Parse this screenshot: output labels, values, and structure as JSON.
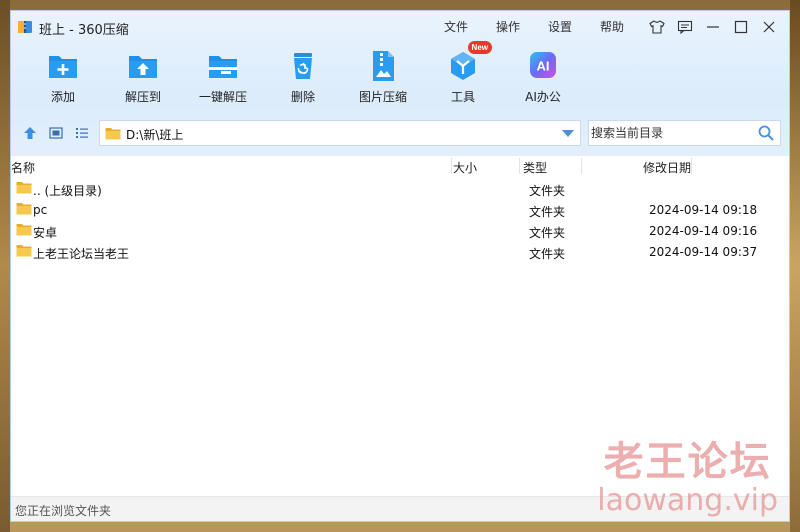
{
  "window": {
    "title": "班上 - 360压缩"
  },
  "menu": [
    "文件",
    "操作",
    "设置",
    "帮助"
  ],
  "toolbar": [
    {
      "label": "添加",
      "icon": "add-folder-icon"
    },
    {
      "label": "解压到",
      "icon": "extract-to-icon"
    },
    {
      "label": "一键解压",
      "icon": "one-click-extract-icon"
    },
    {
      "label": "删除",
      "icon": "delete-icon"
    },
    {
      "label": "图片压缩",
      "icon": "image-compress-icon"
    },
    {
      "label": "工具",
      "icon": "tools-icon",
      "badge": "New"
    },
    {
      "label": "AI办公",
      "icon": "ai-office-icon",
      "glyph": "AI"
    }
  ],
  "nav": {
    "path": "D:\\新\\班上",
    "search_placeholder": "搜索当前目录"
  },
  "columns": {
    "name": "名称",
    "size": "大小",
    "type": "类型",
    "date": "修改日期"
  },
  "files": [
    {
      "name": ".. (上级目录)",
      "type": "文件夹",
      "date": ""
    },
    {
      "name": "pc",
      "type": "文件夹",
      "date": "2024-09-14 09:18"
    },
    {
      "name": "安卓",
      "type": "文件夹",
      "date": "2024-09-14 09:16"
    },
    {
      "name": "上老王论坛当老王",
      "type": "文件夹",
      "date": "2024-09-14 09:37"
    }
  ],
  "status": {
    "text": "您正在浏览文件夹"
  },
  "watermark": {
    "cn": "老王论坛",
    "en": "laowang.vip"
  },
  "colors": {
    "accent": "#1f8fe8",
    "chrome": "#dcecfb",
    "folder": "#f6c84c",
    "badge": "#e8392f"
  }
}
